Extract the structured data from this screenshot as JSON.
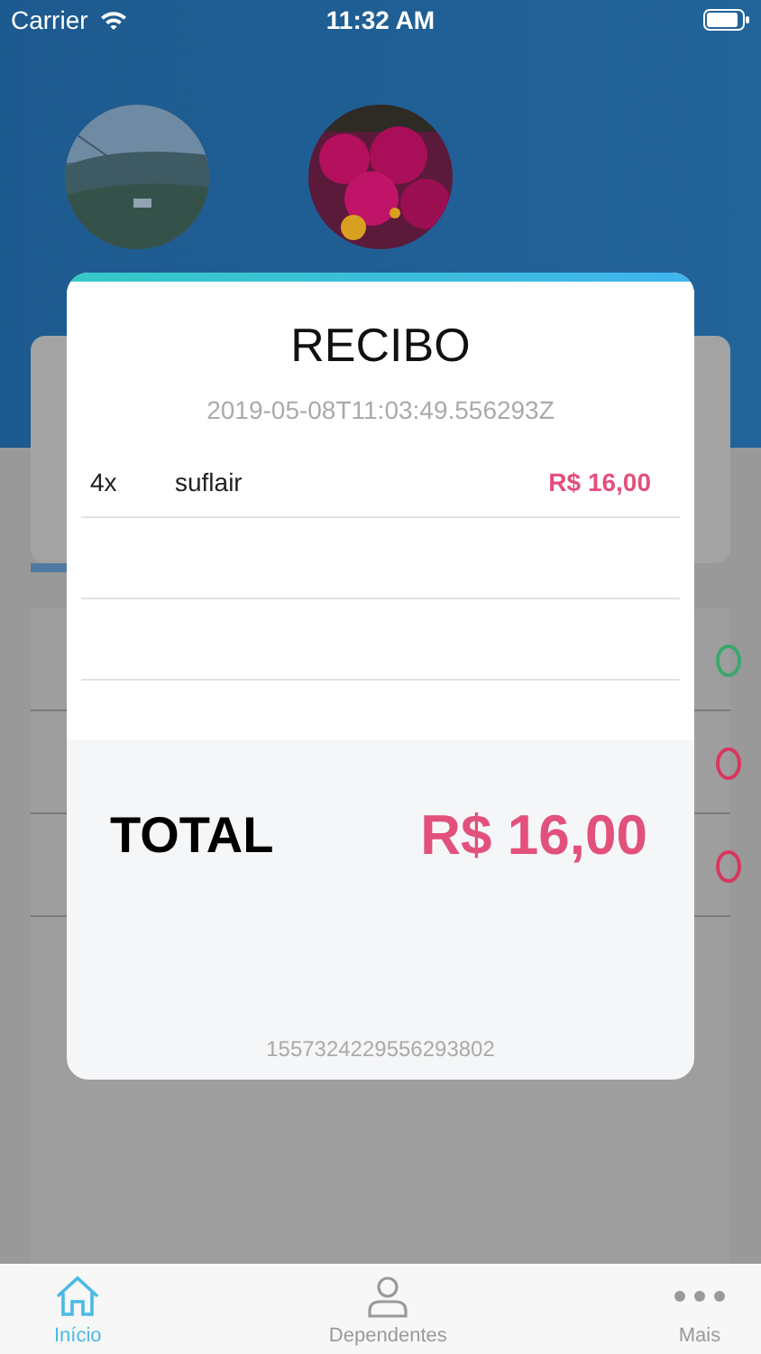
{
  "status_bar": {
    "carrier": "Carrier",
    "time": "11:32 AM"
  },
  "history_rows": [
    {
      "color": "#3aa76d"
    },
    {
      "color": "#d9365e"
    },
    {
      "color": "#d9365e"
    }
  ],
  "receipt": {
    "title": "RECIBO",
    "timestamp": "2019-05-08T11:03:49.556293Z",
    "items": [
      {
        "quantity": "4x",
        "name": "suflair",
        "price": "R$ 16,00"
      }
    ],
    "total_label": "TOTAL",
    "total": "R$ 16,00",
    "code": "1557324229556293802"
  },
  "tabs": [
    {
      "label": "Início",
      "kind": "home",
      "selected": true
    },
    {
      "label": "Dependentes",
      "kind": "person",
      "selected": false
    },
    {
      "label": "Mais",
      "kind": "more",
      "selected": false
    }
  ]
}
